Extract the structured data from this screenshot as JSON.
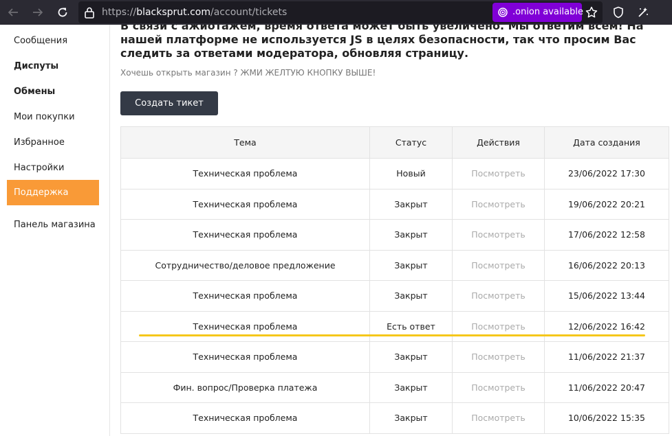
{
  "browser": {
    "url_prefix": "https://",
    "url_host": "blacksprut.com",
    "url_path": "/account/tickets",
    "onion_label": ".onion available",
    "icons": [
      "back-arrow-icon",
      "forward-arrow-icon",
      "reload-icon",
      "lock-icon",
      "onion-icon",
      "star-icon",
      "shield-icon",
      "extension-icon"
    ]
  },
  "sidebar": {
    "items": [
      {
        "label": "Сообщения"
      },
      {
        "label": "Диспуты"
      },
      {
        "label": "Обмены"
      },
      {
        "label": "Мои покупки"
      },
      {
        "label": "Избранное"
      },
      {
        "label": "Настройки"
      },
      {
        "label": "Поддержка"
      },
      {
        "label": "Панель магазина"
      }
    ]
  },
  "main": {
    "notice": "В связи с ажиотажем, время ответа может быть увеличено. Мы ответим всем! На нашей платформе не используется JS в целях безопасности, так что просим Вас следить за ответами модератора, обновляя страницу.",
    "hint": "Хочешь открыть магазин ? ЖМИ ЖЕЛТУЮ КНОПКУ ВЫШЕ!",
    "create_button": "Создать тикет",
    "columns": [
      "Тема",
      "Статус",
      "Действия",
      "Дата создания"
    ],
    "rows": [
      {
        "topic": "Техническая проблема",
        "status": "Новый",
        "action": "Посмотреть",
        "date": "23/06/2022 17:30"
      },
      {
        "topic": "Техническая проблема",
        "status": "Закрыт",
        "action": "Посмотреть",
        "date": "19/06/2022 20:21"
      },
      {
        "topic": "Техническая проблема",
        "status": "Закрыт",
        "action": "Посмотреть",
        "date": "17/06/2022 12:58"
      },
      {
        "topic": "Сотрудничество/деловое предложение",
        "status": "Закрыт",
        "action": "Посмотреть",
        "date": "16/06/2022 20:13"
      },
      {
        "topic": "Техническая проблема",
        "status": "Закрыт",
        "action": "Посмотреть",
        "date": "15/06/2022 13:44"
      },
      {
        "topic": "Техническая проблема",
        "status": "Есть ответ",
        "action": "Посмотреть",
        "date": "12/06/2022 16:42"
      },
      {
        "topic": "Техническая проблема",
        "status": "Закрыт",
        "action": "Посмотреть",
        "date": "11/06/2022 21:37"
      },
      {
        "topic": "Фин. вопрос/Проверка платежа",
        "status": "Закрыт",
        "action": "Посмотреть",
        "date": "11/06/2022 20:47"
      },
      {
        "topic": "Техническая проблема",
        "status": "Закрыт",
        "action": "Посмотреть",
        "date": "10/06/2022 15:35"
      }
    ]
  },
  "colors": {
    "toolbar": "#2b2a33",
    "onion_badge": "#8000d7",
    "accent": "#f99a37",
    "button": "#343a46",
    "highlight_underline": "#f5c71a"
  }
}
